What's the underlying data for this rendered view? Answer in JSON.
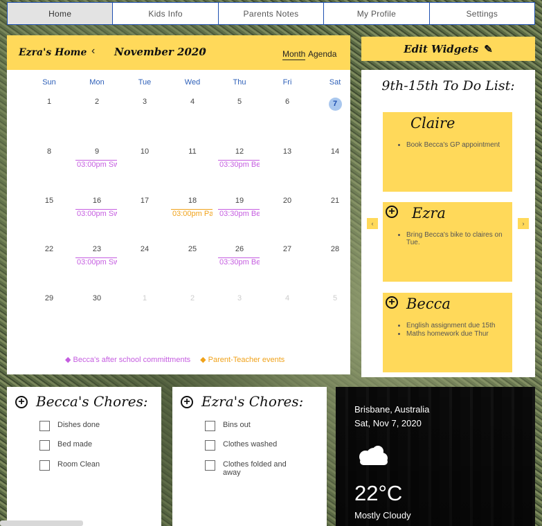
{
  "nav": {
    "tabs": [
      "Home",
      "Kids Info",
      "Parents Notes",
      "My Profile",
      "Settings"
    ],
    "active": "Home"
  },
  "calendar": {
    "owner": "Ezra's Home",
    "month_label": "November 2020",
    "prev_glyph": "‹",
    "next_glyph": "›",
    "view_month": "Month",
    "view_agenda": "Agenda",
    "weekdays": [
      "Sun",
      "Mon",
      "Tue",
      "Wed",
      "Thu",
      "Fri",
      "Sat"
    ],
    "weeks": [
      [
        "1",
        "2",
        "3",
        "4",
        "5",
        "6",
        "7"
      ],
      [
        "8",
        "9",
        "10",
        "11",
        "12",
        "13",
        "14"
      ],
      [
        "15",
        "16",
        "17",
        "18",
        "19",
        "20",
        "21"
      ],
      [
        "22",
        "23",
        "24",
        "25",
        "26",
        "27",
        "28"
      ],
      [
        "29",
        "30",
        "1",
        "2",
        "3",
        "4",
        "5"
      ]
    ],
    "today": "7",
    "events": [
      {
        "week": 1,
        "day": 1,
        "text": "03:00pm Sw",
        "color": "purple"
      },
      {
        "week": 1,
        "day": 4,
        "text": "03:30pm Be",
        "color": "purple"
      },
      {
        "week": 2,
        "day": 1,
        "text": "03:00pm Sw",
        "color": "purple"
      },
      {
        "week": 2,
        "day": 3,
        "text": "03:00pm Pa",
        "color": "orange"
      },
      {
        "week": 2,
        "day": 4,
        "text": "03:30pm Be",
        "color": "purple"
      },
      {
        "week": 3,
        "day": 1,
        "text": "03:00pm Sw",
        "color": "purple"
      },
      {
        "week": 3,
        "day": 4,
        "text": "03:30pm Be",
        "color": "purple"
      }
    ],
    "legend": {
      "purple": "Becca's after school committments",
      "orange": "Parent-Teacher events"
    }
  },
  "edit_widgets": {
    "label": "Edit Widgets",
    "icon": "pencil-icon"
  },
  "todo": {
    "title": "9th-15th To Do List:",
    "notes": [
      {
        "name": "Claire",
        "items": [
          "Book Becca's GP appointment"
        ]
      },
      {
        "name": "Ezra",
        "items": [
          "Bring Becca's bike to claires on Tue."
        ]
      },
      {
        "name": "Becca",
        "items": [
          "English assignment due 15th",
          "Maths homework due Thur"
        ]
      }
    ],
    "arrow_left": "‹",
    "arrow_right": "›"
  },
  "chores": [
    {
      "title": "Becca's Chores:",
      "items": [
        "Dishes done",
        "Bed made",
        "Room Clean"
      ]
    },
    {
      "title": "Ezra's Chores:",
      "items": [
        "Bins out",
        "Clothes washed",
        "Clothes folded and away"
      ]
    }
  ],
  "weather": {
    "location": "Brisbane, Australia",
    "date": "Sat, Nov 7, 2020",
    "icon": "cloud-icon",
    "temperature": "22°C",
    "condition": "Mostly Cloudy"
  },
  "colors": {
    "accent_yellow": "#ffd95a",
    "nav_border": "#1d4fb0",
    "event_purple": "#c55de0",
    "event_orange": "#f0a21a"
  }
}
